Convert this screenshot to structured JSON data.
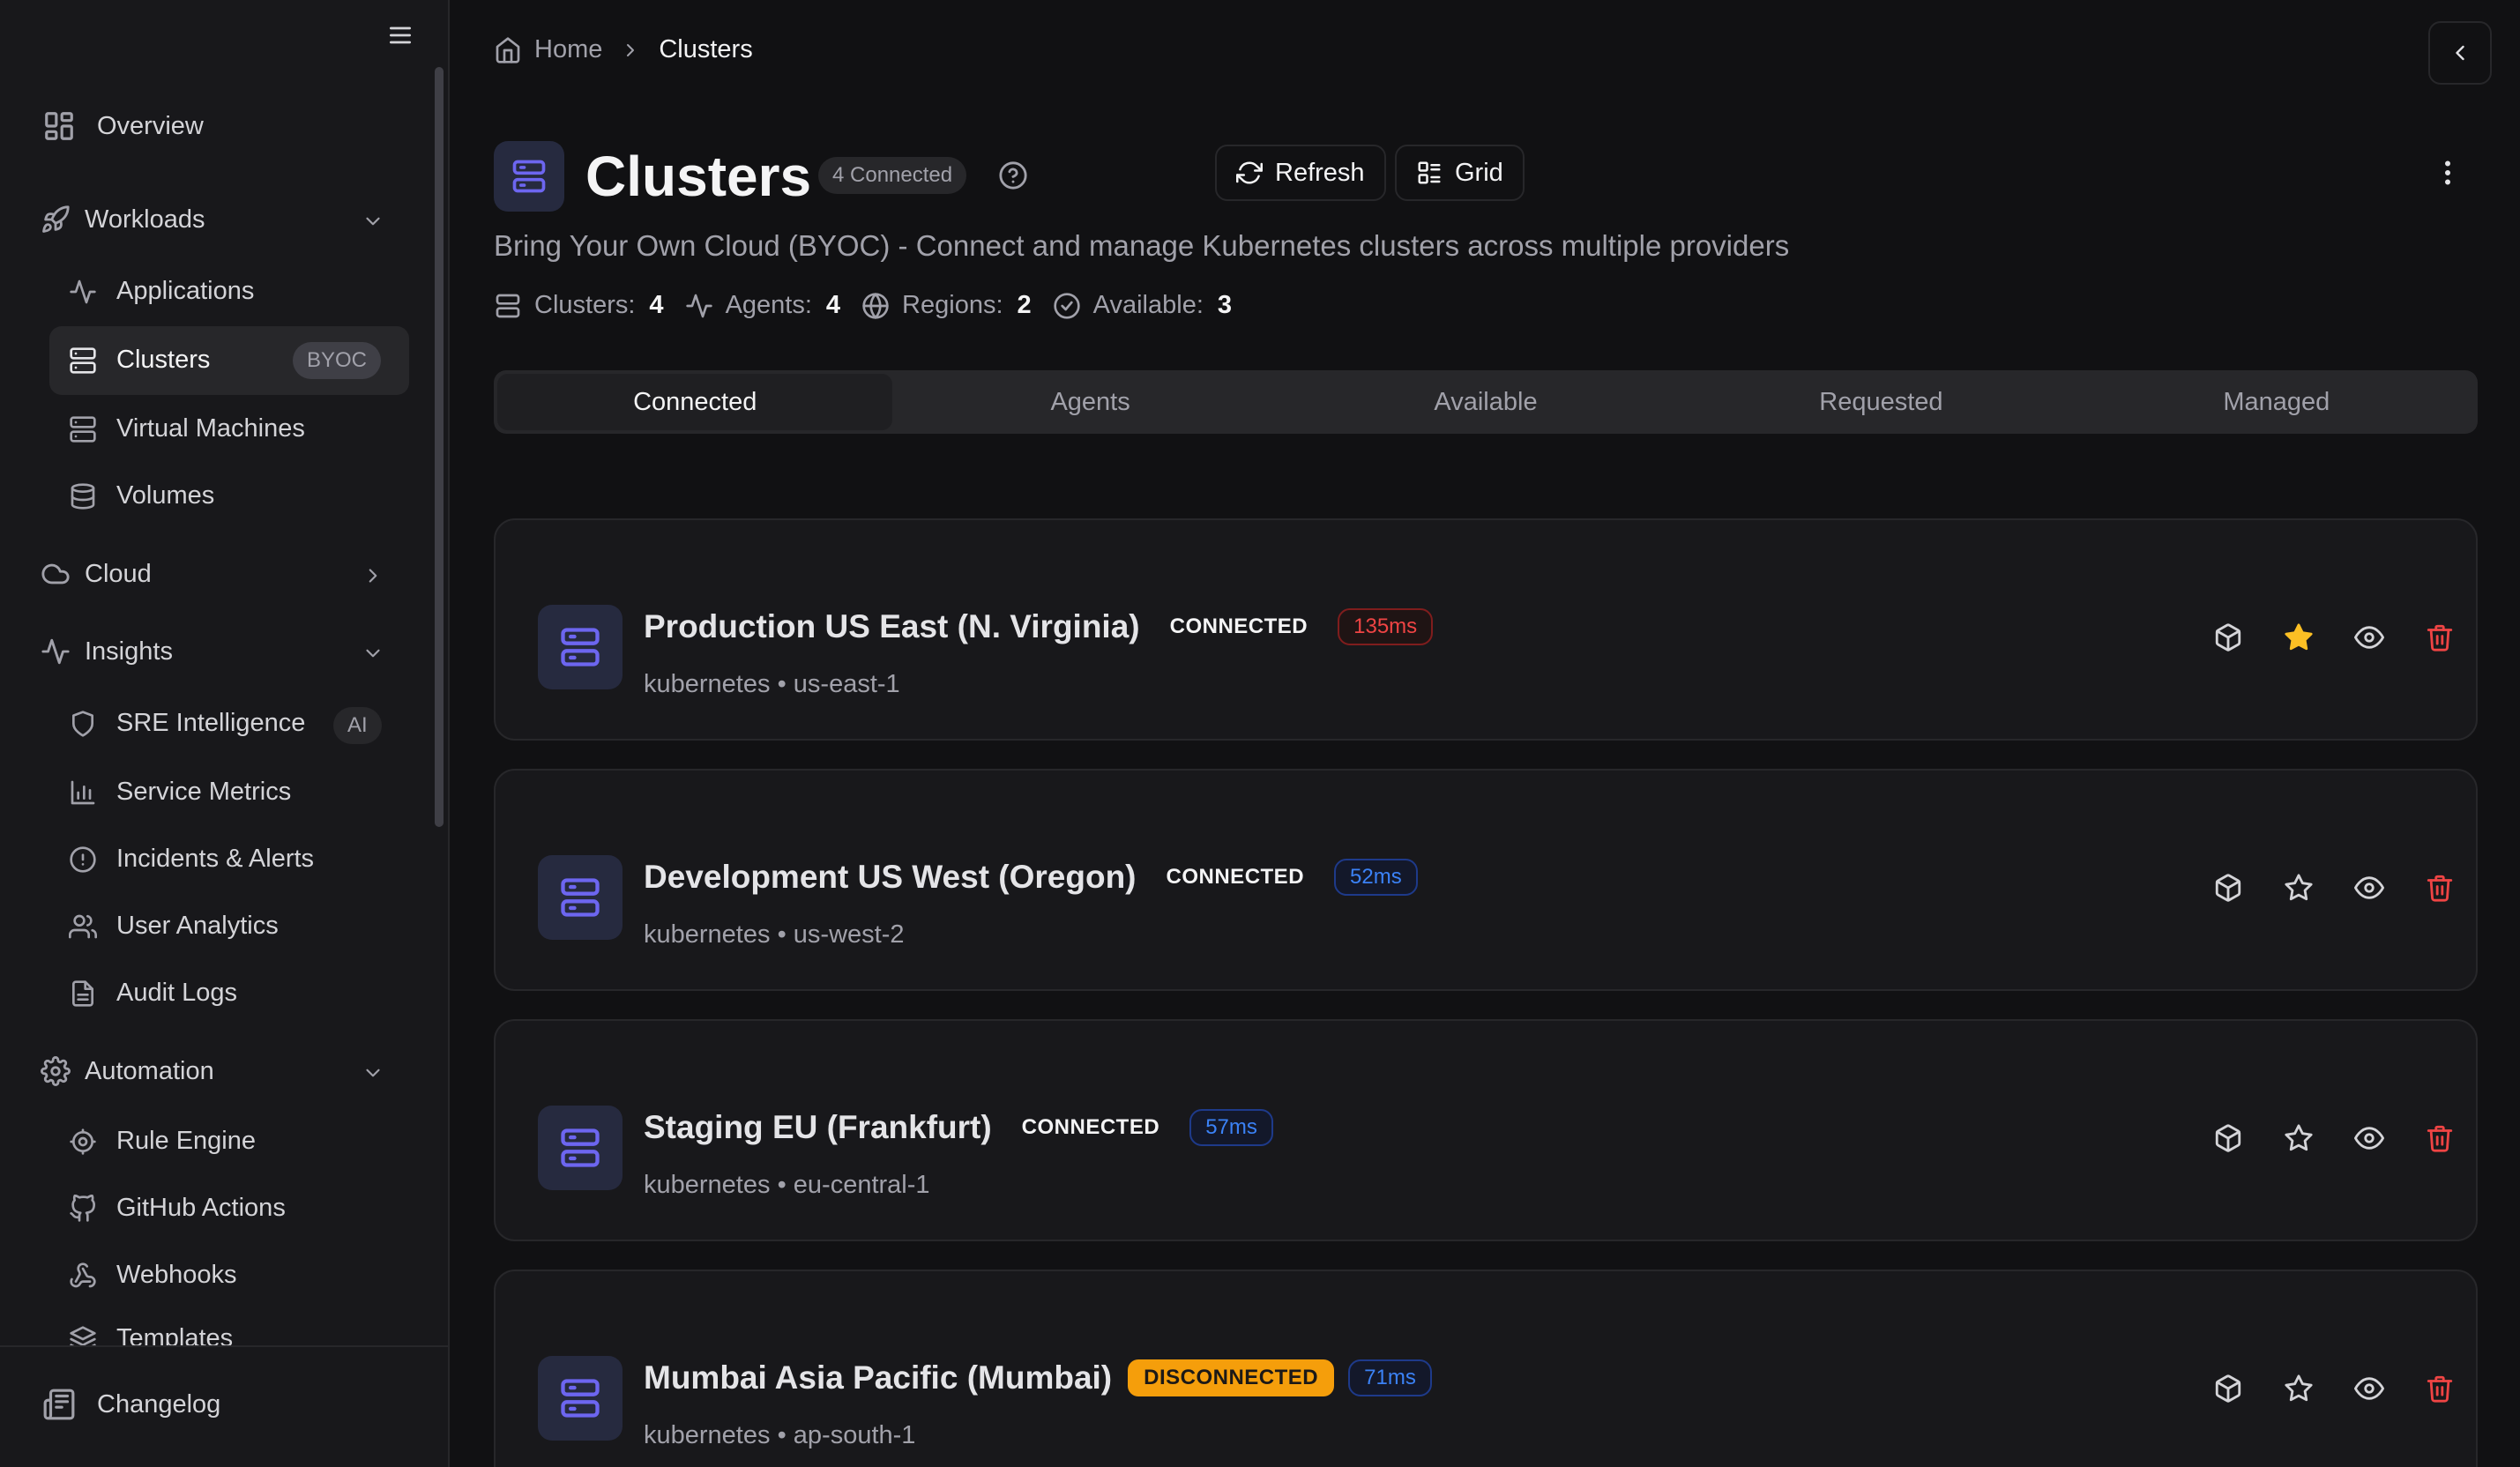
{
  "sidebar": {
    "overview": "Overview",
    "workloads": {
      "label": "Workloads",
      "items": [
        "Applications",
        "Clusters",
        "Virtual Machines",
        "Volumes"
      ],
      "clusters_badge": "BYOC"
    },
    "cloud": "Cloud",
    "insights": {
      "label": "Insights",
      "items": [
        "SRE Intelligence",
        "Service Metrics",
        "Incidents & Alerts",
        "User Analytics",
        "Audit Logs"
      ],
      "sre_badge": "AI"
    },
    "automation": {
      "label": "Automation",
      "items": [
        "Rule Engine",
        "GitHub Actions",
        "Webhooks",
        "Templates"
      ]
    },
    "footer": "Changelog"
  },
  "breadcrumb": {
    "home": "Home",
    "current": "Clusters"
  },
  "header": {
    "title": "Clusters",
    "connected_badge": "4 Connected",
    "refresh": "Refresh",
    "grid": "Grid",
    "subtitle": "Bring Your Own Cloud (BYOC) - Connect and manage Kubernetes clusters across multiple providers"
  },
  "stats": [
    {
      "label": "Clusters:",
      "value": "4",
      "icon": "server-icon"
    },
    {
      "label": "Agents:",
      "value": "4",
      "icon": "activity-icon"
    },
    {
      "label": "Regions:",
      "value": "2",
      "icon": "globe-icon"
    },
    {
      "label": "Available:",
      "value": "3",
      "icon": "check-circle-icon"
    }
  ],
  "tabs": [
    "Connected",
    "Agents",
    "Available",
    "Requested",
    "Managed"
  ],
  "active_tab": "Connected",
  "clusters": [
    {
      "name": "Production US East (N. Virginia)",
      "status": "CONNECTED",
      "latency": "135ms",
      "latency_level": "high",
      "provider": "kubernetes",
      "region": "us-east-1",
      "favorite": true
    },
    {
      "name": "Development US West (Oregon)",
      "status": "CONNECTED",
      "latency": "52ms",
      "latency_level": "low",
      "provider": "kubernetes",
      "region": "us-west-2",
      "favorite": false
    },
    {
      "name": "Staging EU (Frankfurt)",
      "status": "CONNECTED",
      "latency": "57ms",
      "latency_level": "low",
      "provider": "kubernetes",
      "region": "eu-central-1",
      "favorite": false
    },
    {
      "name": "Mumbai Asia Pacific (Mumbai)",
      "status": "DISCONNECTED",
      "latency": "71ms",
      "latency_level": "low",
      "provider": "kubernetes",
      "region": "ap-south-1",
      "favorite": false
    }
  ],
  "meta_separator": "•",
  "colors": {
    "accent": "#6d66f0",
    "warning": "#f59e0b",
    "danger": "#ef4444",
    "info": "#3b82f6",
    "favorite": "#fbbf24"
  }
}
